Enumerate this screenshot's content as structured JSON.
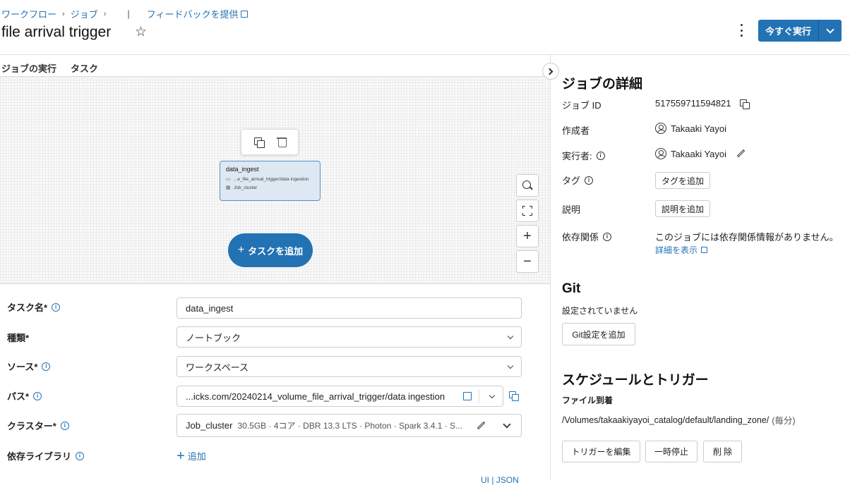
{
  "breadcrumb": {
    "workflows": "ワークフロー",
    "jobs": "ジョブ",
    "separator": "›",
    "divider": "|",
    "feedback": "フィードバックを提供"
  },
  "header": {
    "title": "file arrival trigger",
    "star_icon": "☆",
    "run_now": "今すぐ実行"
  },
  "tabs": {
    "runs": "ジョブの実行",
    "tasks": "タスク"
  },
  "canvas": {
    "node": {
      "name": "data_ingest",
      "path": "...e_file_arrival_trigger/data ingestion",
      "cluster": "Job_cluster"
    },
    "add_task": "タスクを追加",
    "add_task_plus": "+",
    "zoom_in": "+",
    "zoom_out": "−"
  },
  "form": {
    "task_name_label": "タスク名*",
    "task_name_value": "data_ingest",
    "type_label": "種類*",
    "type_value": "ノートブック",
    "source_label": "ソース*",
    "source_value": "ワークスペース",
    "path_label": "パス*",
    "path_value": "...icks.com/20240214_volume_file_arrival_trigger/data ingestion",
    "cluster_label": "クラスター*",
    "cluster_name": "Job_cluster",
    "cluster_detail": "30.5GB · 4コア · DBR 13.3 LTS · Photon · Spark 3.4.1 · S...",
    "libraries_label": "依存ライブラリ",
    "add_label": "追加",
    "add_plus": "+",
    "ui_json": "UI | JSON",
    "info_icon": "i"
  },
  "details": {
    "heading": "ジョブの詳細",
    "job_id_label": "ジョブ ID",
    "job_id": "517559711594821",
    "creator_label": "作成者",
    "creator": "Takaaki Yayoi",
    "run_as_label": "実行者:",
    "run_as": "Takaaki Yayoi",
    "tags_label": "タグ",
    "add_tag": "タグを追加",
    "description_label": "説明",
    "add_description": "説明を追加",
    "dependencies_label": "依存関係",
    "dependencies_text": "このジョブには依存関係情報がありません。",
    "show_details": "詳細を表示"
  },
  "git": {
    "heading": "Git",
    "status": "設定されていません",
    "add_button": "Git設定を追加"
  },
  "schedule": {
    "heading": "スケジュールとトリガー",
    "file_arrival_label": "ファイル到着",
    "path": "/Volumes/takaakiyayoi_catalog/default/landing_zone/",
    "frequency": "(毎分)",
    "edit_trigger": "トリガーを編集",
    "pause": "一時停止",
    "delete": "削 除"
  },
  "colors": {
    "accent": "#2272b4"
  }
}
